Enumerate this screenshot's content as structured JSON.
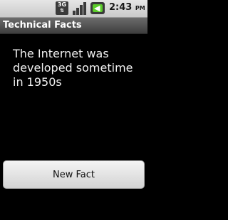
{
  "status_bar": {
    "network_type": "3G",
    "time": "2:43",
    "ampm": "PM",
    "battery_color": "#5ccd2b"
  },
  "app": {
    "title": "Technical Facts"
  },
  "main": {
    "fact_text": "The Internet was developed sometime in 1950s",
    "new_fact_label": "New Fact"
  }
}
